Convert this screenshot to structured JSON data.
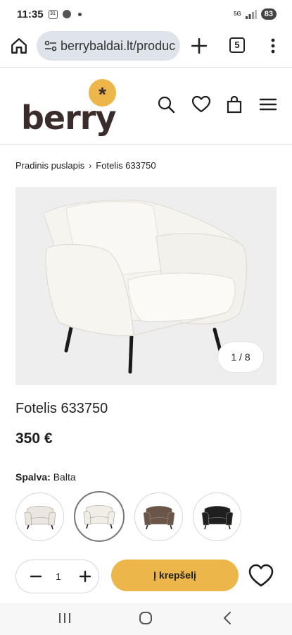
{
  "status_bar": {
    "time": "11:35",
    "left_icons": [
      "calendar-icon",
      "settings-icon",
      "notification-dot-icon"
    ],
    "network_tag": "5G",
    "battery": "83"
  },
  "browser": {
    "url": "berrybaldai.lt/produc",
    "tab_count": "5"
  },
  "header": {
    "logo_text": "berry",
    "logo_mark": "*",
    "brand_color": "#edb64a",
    "icons": [
      "search-icon",
      "heart-icon",
      "bag-icon",
      "hamburger-menu-icon"
    ]
  },
  "breadcrumb": {
    "home": "Pradinis puslapis",
    "separator": "›",
    "current": "Fotelis 633750"
  },
  "gallery": {
    "counter": "1 / 8"
  },
  "product": {
    "title": "Fotelis 633750",
    "price": "350 €",
    "color_label": "Spalva:",
    "color_value": "Balta"
  },
  "swatches": [
    {
      "color": "#ebe6e0",
      "selected": false
    },
    {
      "color": "#f1eee8",
      "selected": true
    },
    {
      "color": "#6b5548",
      "selected": false
    },
    {
      "color": "#1f1f1f",
      "selected": false
    }
  ],
  "cart": {
    "minus": "−",
    "quantity": "1",
    "plus": "+",
    "add_label": "Į krepšelį"
  },
  "nav": {
    "icons": [
      "recents-icon",
      "home-circle-icon",
      "back-icon"
    ]
  }
}
